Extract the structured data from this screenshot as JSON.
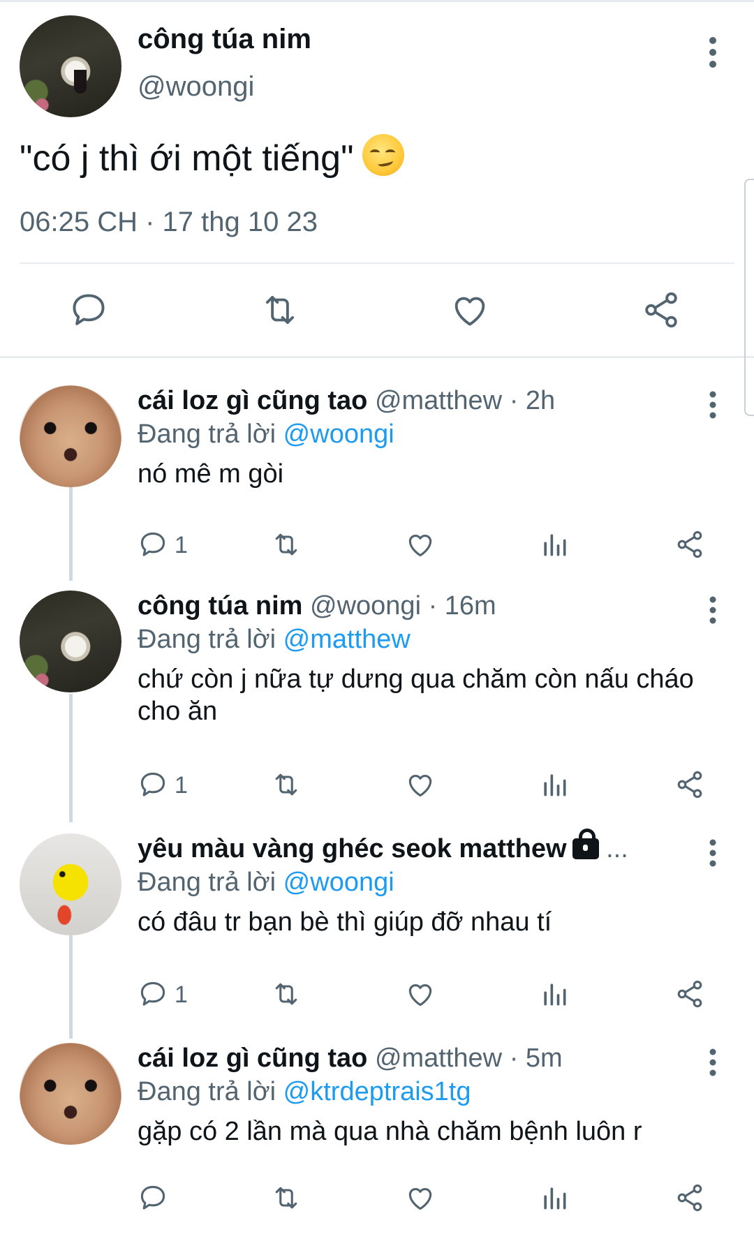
{
  "main_tweet": {
    "author_name": "công túa nim",
    "author_handle": "@woongi",
    "text": "\"có j thì ới một tiếng\"",
    "emoji": "smirking-face",
    "timestamp": "06:25 CH · 17 thg 10 23",
    "actions": [
      "reply-icon",
      "retweet-icon",
      "like-icon",
      "share-icon"
    ]
  },
  "replies": [
    {
      "author_name": "cái loz gì cũng tao",
      "author_handle": "@matthew",
      "time": "· 2h",
      "replying_prefix": "Đang trả lời",
      "replying_to": "@woongi",
      "text": "nó mê m gòi",
      "reply_count": "1",
      "avatar": "dog-avatar"
    },
    {
      "author_name": "công túa nim",
      "author_handle": "@woongi",
      "time": "· 16m",
      "replying_prefix": "Đang trả lời",
      "replying_to": "@matthew",
      "text": "chứ còn j nữa tự dưng qua chăm còn nấu cháo cho ăn",
      "reply_count": "1",
      "avatar": "cake-avatar"
    },
    {
      "author_name": "yêu màu vàng ghéc seok matthew",
      "author_handle": "...",
      "time": "",
      "replying_prefix": "Đang trả lời",
      "replying_to": "@woongi",
      "text": "có đâu tr bạn bè thì giúp đỡ nhau tí",
      "reply_count": "1",
      "avatar": "chick-avatar",
      "locked": true
    },
    {
      "author_name": "cái loz gì cũng tao",
      "author_handle": "@matthew",
      "time": "· 5m",
      "replying_prefix": "Đang trả lời",
      "replying_to": "@ktrdeptrais1tg",
      "text": "gặp có 2 lần mà qua nhà chăm bệnh luôn r",
      "reply_count": "",
      "avatar": "dog-avatar"
    }
  ],
  "colors": {
    "text": "#0f1419",
    "secondary": "#536471",
    "link": "#1d9bf0",
    "divider": "#e6ecf0"
  }
}
